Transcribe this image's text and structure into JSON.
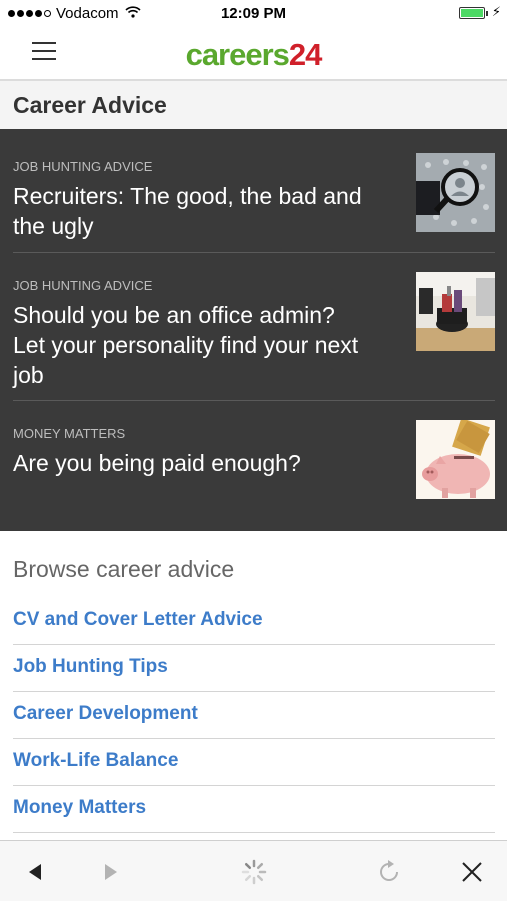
{
  "status_bar": {
    "carrier": "Vodacom",
    "time": "12:09 PM"
  },
  "header": {
    "logo_word": "careers",
    "logo_number": "24",
    "menu_icon": "hamburger-icon"
  },
  "section_title": "Career Advice",
  "articles": [
    {
      "category": "JOB HUNTING ADVICE",
      "headline": "Recruiters: The good, the bad and the ugly"
    },
    {
      "category": "JOB HUNTING ADVICE",
      "headline": "Should you be an office admin? Let your personality find your next job"
    },
    {
      "category": "MONEY MATTERS",
      "headline": "Are you being paid enough?"
    }
  ],
  "browse": {
    "title": "Browse career advice",
    "items": [
      "CV and Cover Letter Advice",
      "Job Hunting Tips",
      "Career Development",
      "Work-Life Balance",
      "Money Matters"
    ]
  },
  "toolbar": {
    "icons": [
      "back-icon",
      "forward-icon",
      "loading-spinner-icon",
      "reload-icon",
      "close-icon"
    ]
  },
  "colors": {
    "logo_green": "#5aa82e",
    "logo_red": "#d0202a",
    "link_blue": "#3d7cc9",
    "dark_panel": "#3a3a3a"
  }
}
